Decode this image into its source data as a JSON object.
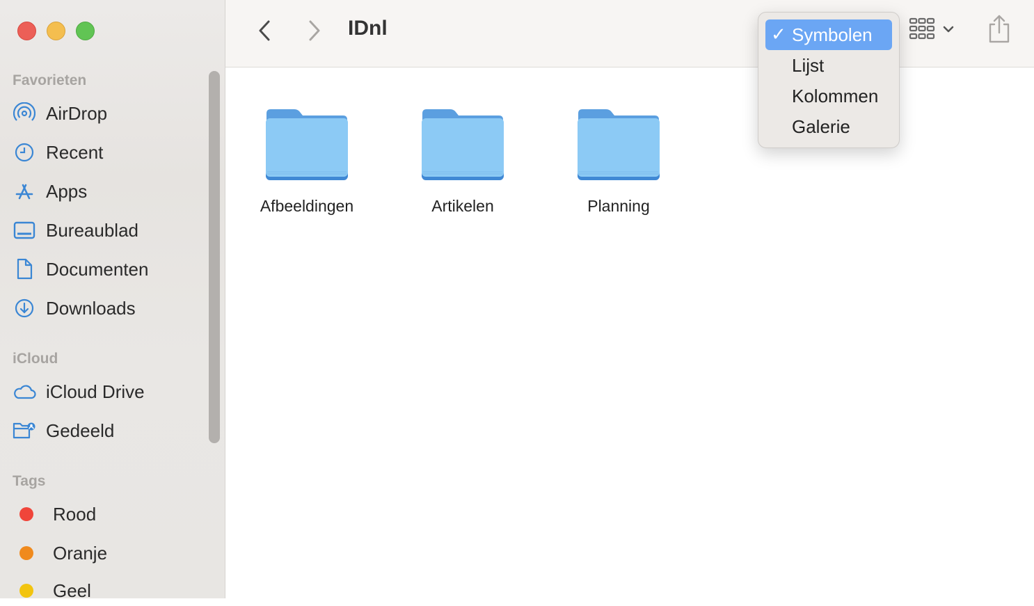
{
  "window": {
    "title": "IDnl"
  },
  "sidebar": {
    "favorites_title": "Favorieten",
    "favorites": [
      {
        "label": "AirDrop",
        "icon": "airdrop-icon"
      },
      {
        "label": "Recent",
        "icon": "clock-icon"
      },
      {
        "label": "Apps",
        "icon": "apps-icon"
      },
      {
        "label": "Bureaublad",
        "icon": "desktop-icon"
      },
      {
        "label": "Documenten",
        "icon": "document-icon"
      },
      {
        "label": "Downloads",
        "icon": "download-icon"
      }
    ],
    "icloud_title": "iCloud",
    "icloud": [
      {
        "label": "iCloud Drive",
        "icon": "cloud-icon"
      },
      {
        "label": "Gedeeld",
        "icon": "shared-folder-icon"
      }
    ],
    "tags_title": "Tags",
    "tags": [
      {
        "label": "Rood",
        "color": "#f0453a"
      },
      {
        "label": "Oranje",
        "color": "#f08a1d"
      },
      {
        "label": "Geel",
        "color": "#f2c40f"
      }
    ]
  },
  "folders": [
    {
      "label": "Afbeeldingen"
    },
    {
      "label": "Artikelen"
    },
    {
      "label": "Planning"
    }
  ],
  "view_menu": {
    "items": [
      {
        "label": "Symbolen",
        "selected": true,
        "check": "✓"
      },
      {
        "label": "Lijst"
      },
      {
        "label": "Kolommen"
      },
      {
        "label": "Galerie"
      }
    ]
  },
  "colors": {
    "accent": "#6ba6f4",
    "folder": "#8ccaf5",
    "icon_blue": "#3a86d4"
  }
}
